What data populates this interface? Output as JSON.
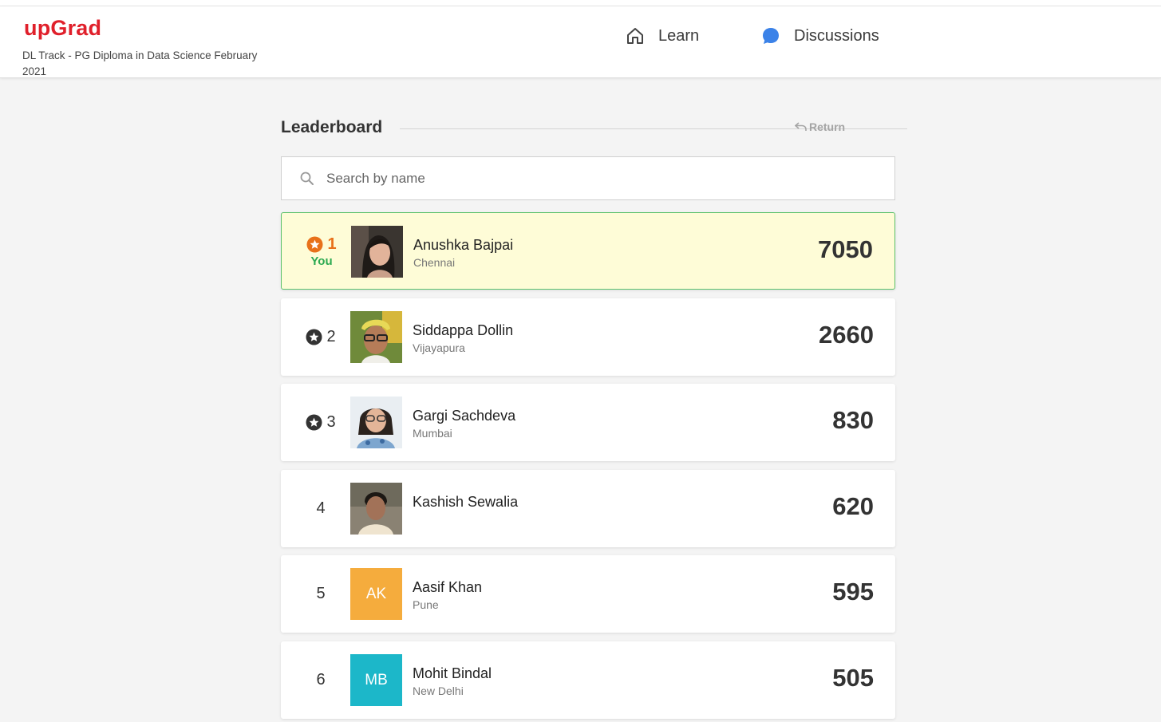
{
  "header": {
    "brand": "upGrad",
    "program": "DL Track - PG Diploma in Data Science February 2021",
    "nav": [
      {
        "label": "Learn",
        "icon": "home-icon"
      },
      {
        "label": "Discussions",
        "icon": "chat-bubble-icon"
      }
    ]
  },
  "leaderboard": {
    "title": "Leaderboard",
    "return_label": "Return",
    "search_placeholder": "Search by name",
    "you_label": "You",
    "rows": [
      {
        "rank": "1",
        "name": "Anushka Bajpai",
        "city": "Chennai",
        "score": "7050",
        "is_you": true,
        "star": true,
        "avatar": "photo"
      },
      {
        "rank": "2",
        "name": "Siddappa Dollin",
        "city": "Vijayapura",
        "score": "2660",
        "star": true,
        "avatar": "photo"
      },
      {
        "rank": "3",
        "name": "Gargi Sachdeva",
        "city": "Mumbai",
        "score": "830",
        "star": true,
        "avatar": "photo"
      },
      {
        "rank": "4",
        "name": "Kashish Sewalia",
        "city": "",
        "score": "620",
        "star": false,
        "avatar": "photo"
      },
      {
        "rank": "5",
        "name": "Aasif Khan",
        "city": "Pune",
        "score": "595",
        "star": false,
        "avatar_initials": "AK",
        "avatar_color": "#f5ac3d"
      },
      {
        "rank": "6",
        "name": "Mohit Bindal",
        "city": "New Delhi",
        "score": "505",
        "star": false,
        "avatar_initials": "MB",
        "avatar_color": "#1cb7c9"
      }
    ]
  },
  "colors": {
    "brand": "#e0202b",
    "you_bg": "#fefcd7",
    "you_border": "#5cc16b",
    "you_rank": "#e8711a",
    "you_label": "#2daa52"
  }
}
